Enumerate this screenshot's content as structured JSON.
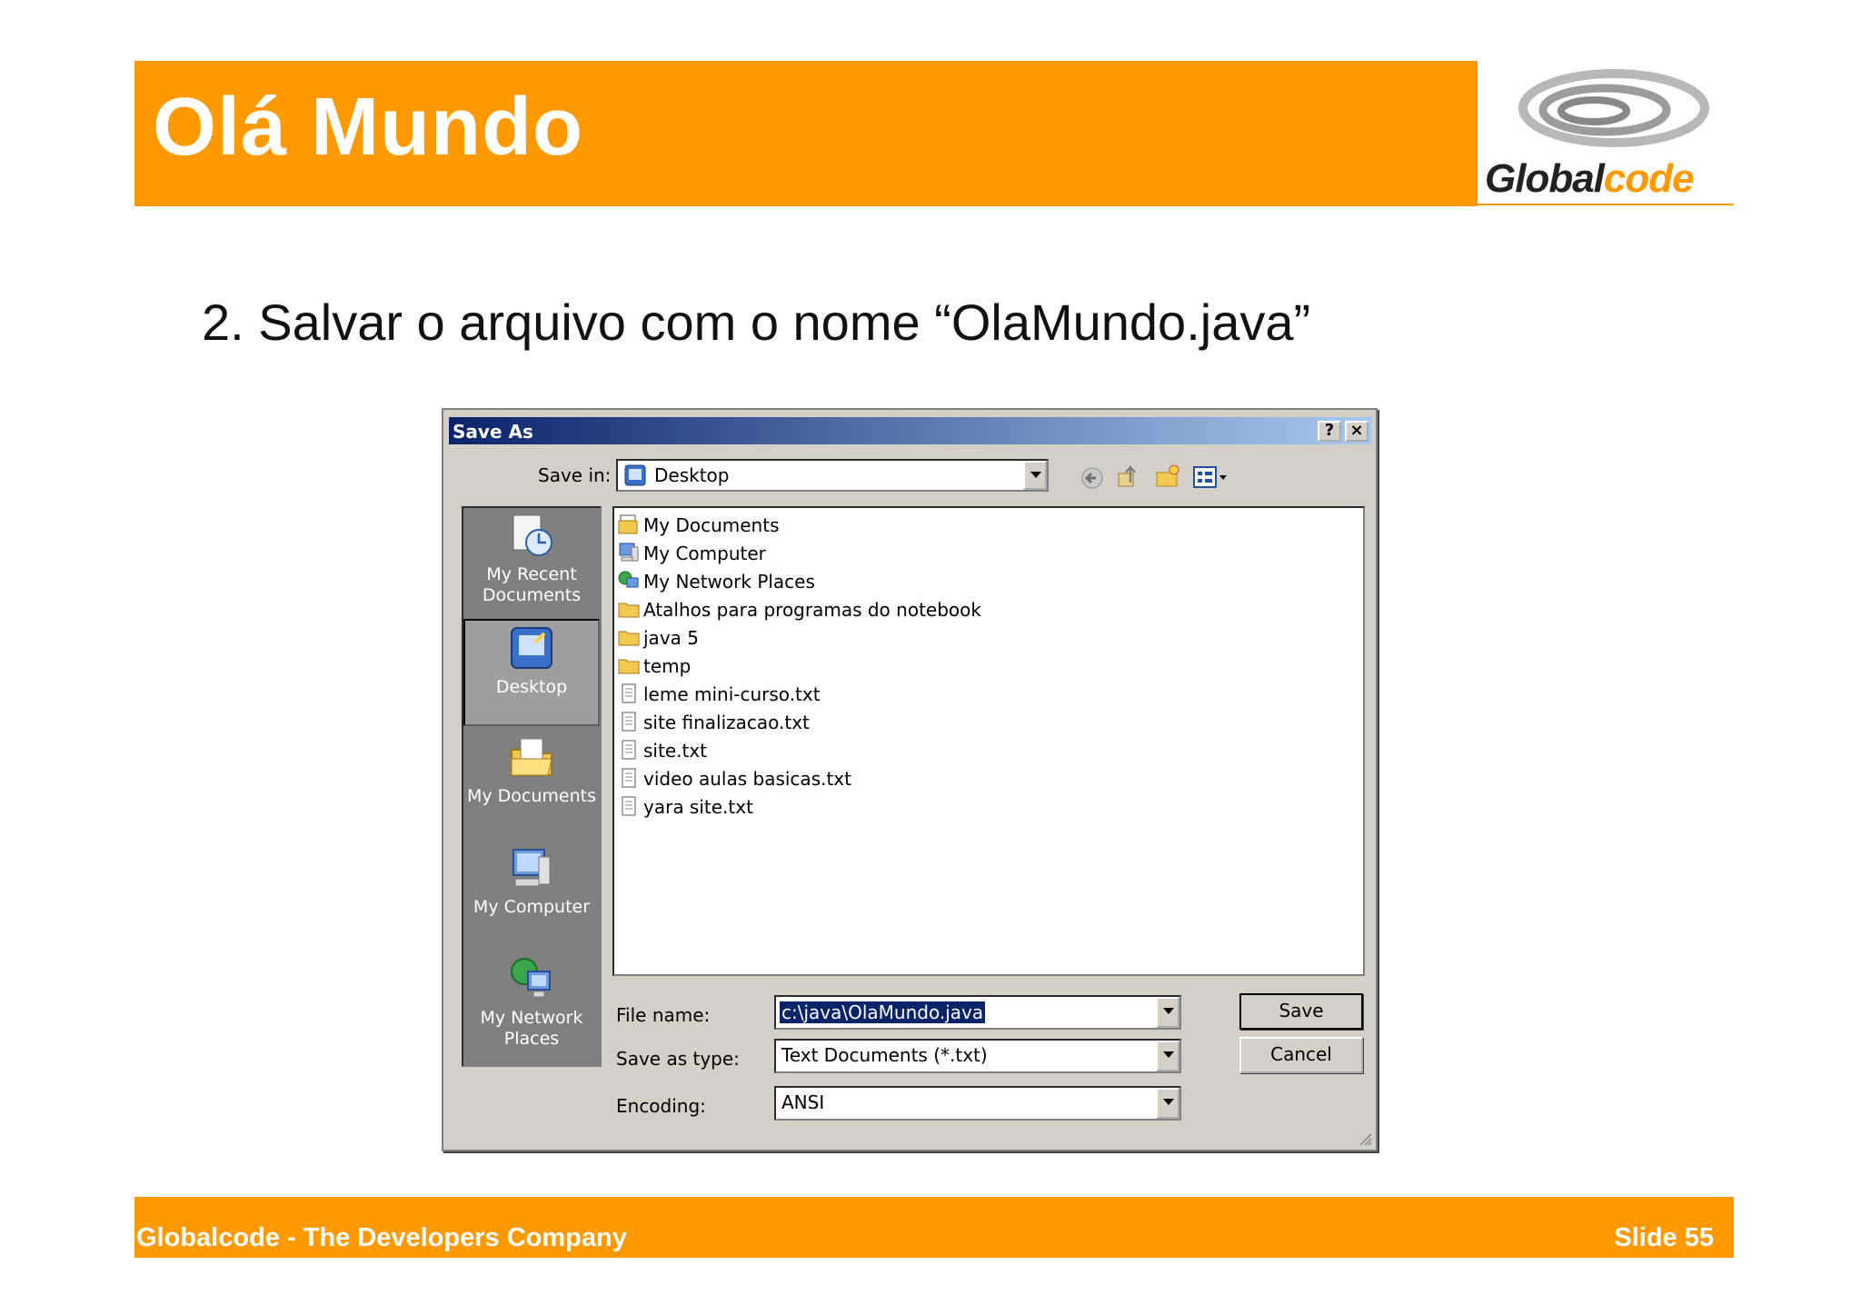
{
  "slide": {
    "title": "Olá Mundo",
    "subtitle": "2. Salvar o arquivo com o nome “OlaMundo.java”",
    "logo_part1": "Global",
    "logo_part2": "code",
    "footer_left": "Globalcode - The Developers Company",
    "footer_right": "Slide 55",
    "accent_color": "#FF9900"
  },
  "dialog": {
    "title": "Save As",
    "help_label": "?",
    "close_label": "×",
    "save_in_label": "Save in:",
    "save_in_value": "Desktop",
    "places": [
      {
        "label1": "My Recent",
        "label2": "Documents",
        "icon": "recent-documents-icon"
      },
      {
        "label1": "Desktop",
        "label2": "",
        "icon": "desktop-icon"
      },
      {
        "label1": "My Documents",
        "label2": "",
        "icon": "my-documents-icon"
      },
      {
        "label1": "My Computer",
        "label2": "",
        "icon": "my-computer-icon"
      },
      {
        "label1": "My Network",
        "label2": "Places",
        "icon": "network-places-icon"
      }
    ],
    "files": [
      {
        "name": "My Documents",
        "icon": "my-documents-icon"
      },
      {
        "name": "My Computer",
        "icon": "my-computer-icon"
      },
      {
        "name": "My Network Places",
        "icon": "network-places-icon"
      },
      {
        "name": "Atalhos para programas do notebook",
        "icon": "folder-icon"
      },
      {
        "name": "java 5",
        "icon": "folder-icon"
      },
      {
        "name": "temp",
        "icon": "folder-icon"
      },
      {
        "name": "leme mini-curso.txt",
        "icon": "text-file-icon"
      },
      {
        "name": "site finalizacao.txt",
        "icon": "text-file-icon"
      },
      {
        "name": "site.txt",
        "icon": "text-file-icon"
      },
      {
        "name": "video aulas basicas.txt",
        "icon": "text-file-icon"
      },
      {
        "name": "yara site.txt",
        "icon": "text-file-icon"
      }
    ],
    "file_name_label": "File name:",
    "file_name_value": "c:\\java\\OlaMundo.java",
    "save_type_label": "Save as type:",
    "save_type_value": "Text Documents (*.txt)",
    "encoding_label": "Encoding:",
    "encoding_value": "ANSI",
    "save_button": "Save",
    "cancel_button": "Cancel"
  }
}
